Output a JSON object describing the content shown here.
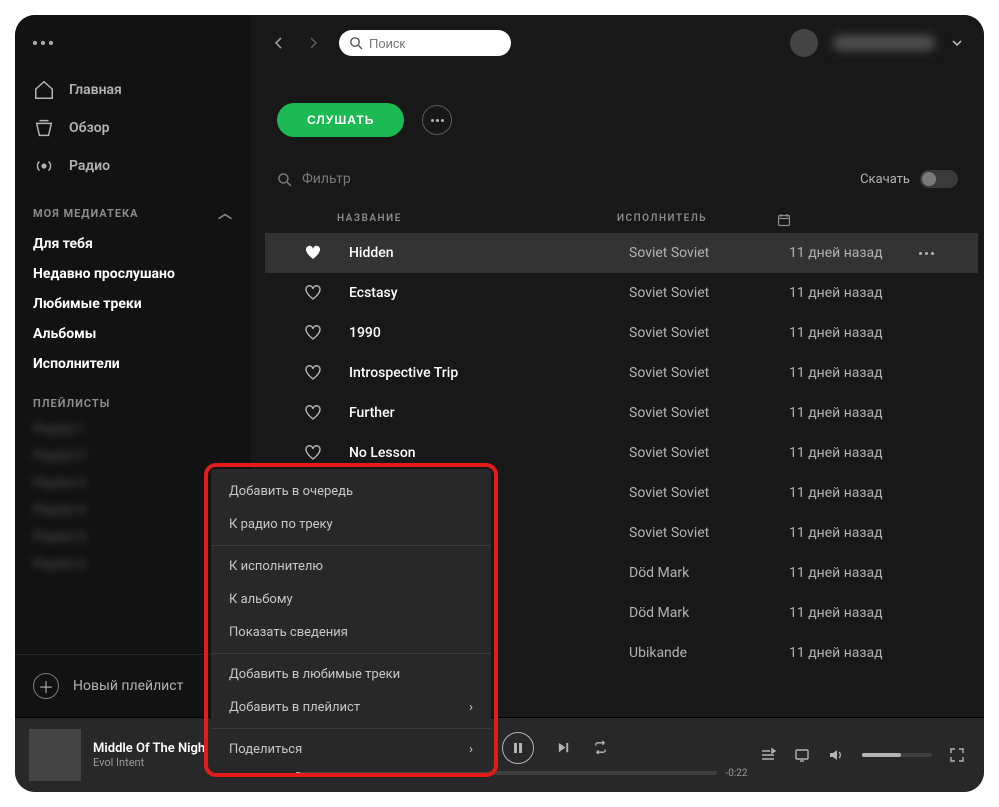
{
  "search": {
    "placeholder": "Поиск"
  },
  "nav": {
    "home": "Главная",
    "browse": "Обзор",
    "radio": "Радио"
  },
  "library": {
    "header": "МОЯ МЕДИАТЕКА",
    "items": [
      "Для тебя",
      "Недавно прослушано",
      "Любимые треки",
      "Альбомы",
      "Исполнители"
    ]
  },
  "playlists": {
    "header": "ПЛЕЙЛИСТЫ",
    "items": [
      "Playlist 1",
      "Playlist 2",
      "Playlist 3",
      "Playlist 4",
      "Playlist 5",
      "Playlist 6"
    ]
  },
  "new_playlist": "Новый плейлист",
  "listen": "СЛУШАТЬ",
  "filter": {
    "placeholder": "Фильтр"
  },
  "download_label": "Скачать",
  "columns": {
    "title": "НАЗВАНИЕ",
    "artist": "ИСПОЛНИТЕЛЬ"
  },
  "rows": [
    {
      "title": "Hidden",
      "artist": "Soviet Soviet",
      "date": "11 дней назад",
      "liked": true,
      "selected": true
    },
    {
      "title": "Ecstasy",
      "artist": "Soviet Soviet",
      "date": "11 дней назад",
      "liked": false
    },
    {
      "title": "1990",
      "artist": "Soviet Soviet",
      "date": "11 дней назад",
      "liked": false
    },
    {
      "title": "Introspective Trip",
      "artist": "Soviet Soviet",
      "date": "11 дней назад",
      "liked": false
    },
    {
      "title": "Further",
      "artist": "Soviet Soviet",
      "date": "11 дней назад",
      "liked": false
    },
    {
      "title": "No Lesson",
      "artist": "Soviet Soviet",
      "date": "11 дней назад",
      "liked": false
    },
    {
      "title": "",
      "artist": "Soviet Soviet",
      "date": "11 дней назад",
      "liked": false
    },
    {
      "title": "",
      "artist": "Soviet Soviet",
      "date": "11 дней назад",
      "liked": false
    },
    {
      "title": "",
      "artist": "Död Mark",
      "date": "11 дней назад",
      "liked": false
    },
    {
      "title": "",
      "artist": "Död Mark",
      "date": "11 дней назад",
      "liked": false
    },
    {
      "title": "",
      "artist": "Ubikande",
      "date": "11 дней назад",
      "liked": false
    }
  ],
  "context_menu": {
    "groups": [
      [
        "Добавить в очередь",
        "К радио по треку"
      ],
      [
        "К исполнителю",
        "К альбому",
        "Показать сведения"
      ],
      [
        "Добавить в любимые треки"
      ]
    ],
    "submenu": [
      "Добавить в плейлист",
      "Поделиться"
    ]
  },
  "player": {
    "track": "Middle Of The Nigh",
    "artist": "Evol Intent",
    "time_remaining": "-0:22"
  }
}
